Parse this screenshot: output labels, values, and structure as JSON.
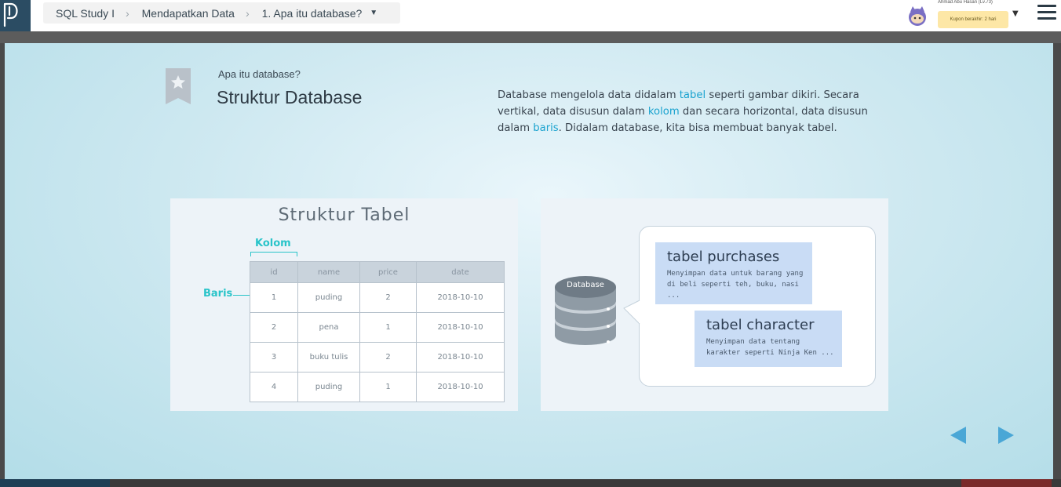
{
  "breadcrumb": {
    "course": "SQL Study I",
    "chapter": "Mendapatkan Data",
    "lesson": "1. Apa itu database?"
  },
  "user": {
    "name": "Ahmad Abu Hasan (Lv.73)",
    "coupon": "Kupon berakhir: 2 hari"
  },
  "slide": {
    "subtitle": "Apa itu database?",
    "title": "Struktur Database",
    "desc_1": "Database mengelola data didalam ",
    "desc_hl_1": "tabel",
    "desc_2": " seperti gambar dikiri. Secara vertikal, data disusun dalam ",
    "desc_hl_2": "kolom",
    "desc_3": " dan secara horizontal, data disusun dalam ",
    "desc_hl_3": "baris",
    "desc_4": ". Didalam database, kita bisa membuat banyak tabel."
  },
  "table_figure": {
    "title": "Struktur Tabel",
    "kolom_label": "Kolom",
    "baris_label": "Baris",
    "headers": [
      "id",
      "name",
      "price",
      "date"
    ],
    "rows": [
      [
        "1",
        "puding",
        "2",
        "2018-10-10"
      ],
      [
        "2",
        "pena",
        "1",
        "2018-10-10"
      ],
      [
        "3",
        "buku tulis",
        "2",
        "2018-10-10"
      ],
      [
        "4",
        "puding",
        "1",
        "2018-10-10"
      ]
    ]
  },
  "database_figure": {
    "db_label": "Database",
    "cards": [
      {
        "title": "tabel purchases",
        "desc_1": "Menyimpan data untuk barang yang",
        "desc_2": "di beli seperti teh, buku, nasi ..."
      },
      {
        "title": "tabel character",
        "desc_1": "Menyimpan data tentang",
        "desc_2": "karakter seperti Ninja Ken ..."
      }
    ]
  },
  "colors": {
    "accent": "#1ba3cf",
    "figure_accent": "#29c4c9",
    "nav_arrow": "#4aa7d6",
    "topbar_brand": "#2b4c63"
  },
  "icons": [
    "logo-icon",
    "chevron-right-icon",
    "caret-down-icon",
    "avatar-icon",
    "menu-icon",
    "bookmark-star-icon",
    "database-icon",
    "arrow-left-icon",
    "arrow-right-icon"
  ]
}
